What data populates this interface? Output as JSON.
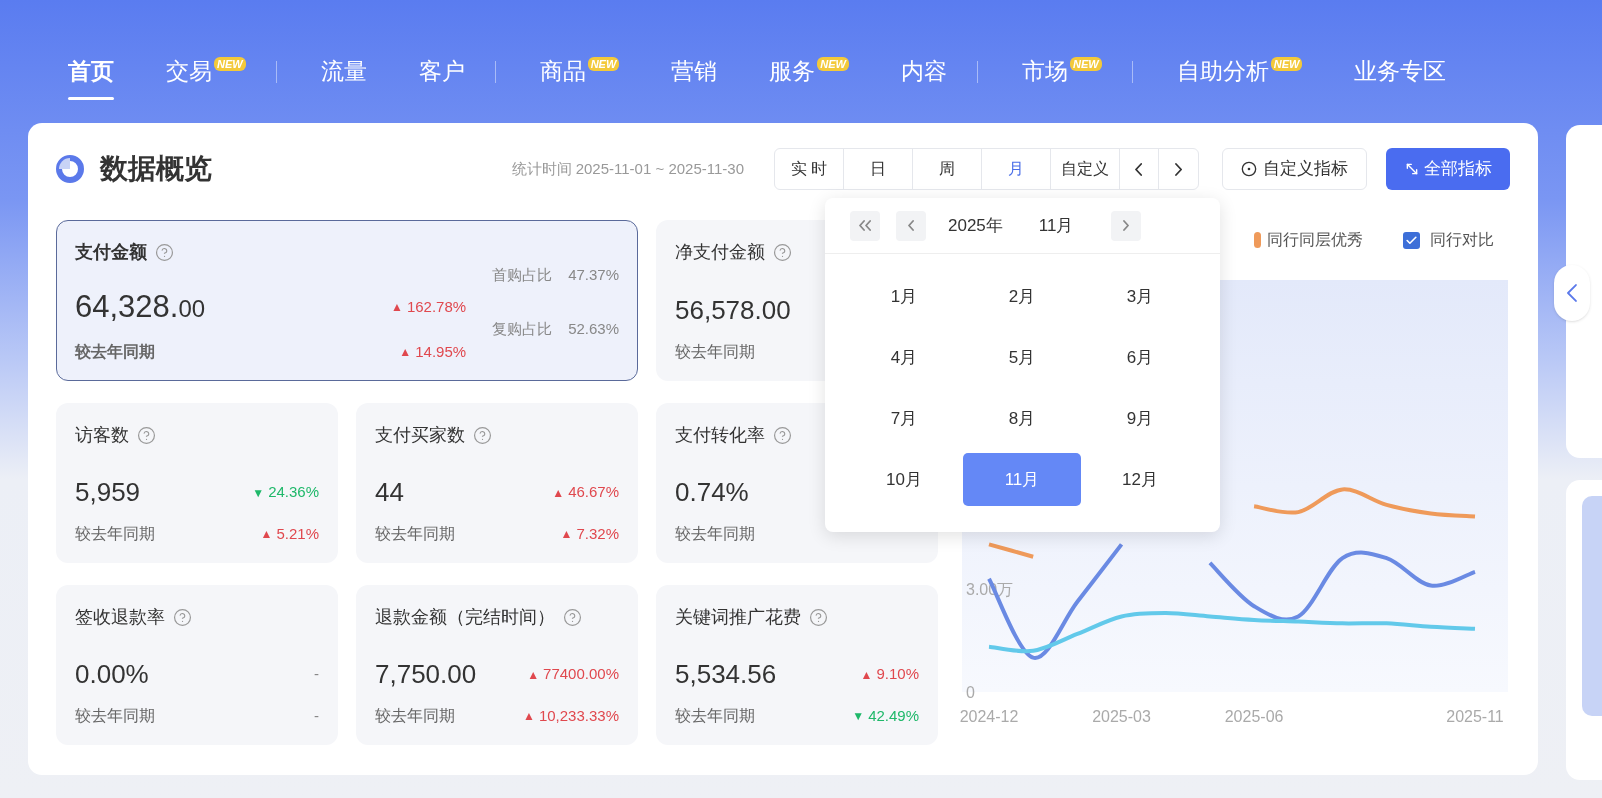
{
  "nav": [
    {
      "kind": "item",
      "label": "首页",
      "selected": true
    },
    {
      "kind": "item",
      "label": "交易",
      "badge": "NEW",
      "selected": false
    },
    {
      "kind": "divider"
    },
    {
      "kind": "item",
      "label": "流量",
      "selected": false
    },
    {
      "kind": "item",
      "label": "客户",
      "selected": false
    },
    {
      "kind": "divider"
    },
    {
      "kind": "item",
      "label": "商品",
      "badge": "NEW",
      "selected": false
    },
    {
      "kind": "item",
      "label": "营销",
      "selected": false
    },
    {
      "kind": "item",
      "label": "服务",
      "badge": "NEW",
      "selected": false
    },
    {
      "kind": "item",
      "label": "内容",
      "selected": false
    },
    {
      "kind": "divider"
    },
    {
      "kind": "item",
      "label": "市场",
      "badge": "NEW",
      "selected": false
    },
    {
      "kind": "divider"
    },
    {
      "kind": "item",
      "label": "自助分析",
      "badge": "NEW",
      "selected": false
    },
    {
      "kind": "item",
      "label": "业务专区",
      "selected": false
    }
  ],
  "overview": {
    "title": "数据概览",
    "period": "统计时间 2025-11-01 ~ 2025-11-30",
    "ranges": [
      {
        "kind": "text",
        "label": "实 时",
        "selected": false
      },
      {
        "kind": "text",
        "label": "日",
        "selected": false
      },
      {
        "kind": "text",
        "label": "周",
        "selected": false
      },
      {
        "kind": "text",
        "label": "月",
        "selected": true
      },
      {
        "kind": "text",
        "label": "自定义",
        "selected": false
      },
      {
        "kind": "prev"
      },
      {
        "kind": "next"
      }
    ],
    "buttons": [
      {
        "kind": "outline",
        "label": "自定义指标"
      },
      {
        "kind": "primary",
        "label": "全部指标"
      }
    ]
  },
  "metrics": [
    {
      "title": "支付金额",
      "value": "64,328.",
      "value_small": "00",
      "selected": true,
      "compare": "较去年同期",
      "change": {
        "kind": "up",
        "arrow": "▲",
        "text": "162.78%"
      },
      "compare_change": {
        "kind": "up",
        "arrow": "▲",
        "text": "14.95%"
      },
      "ratios": [
        {
          "label": "首购占比",
          "value": "47.37%"
        },
        {
          "label": "复购占比",
          "value": "52.63%"
        }
      ]
    },
    {
      "title": "净支付金额",
      "value": "56,578.00",
      "selected": false,
      "compare": "较去年同期"
    },
    {
      "title": "访客数",
      "value": "5,959",
      "selected": false,
      "compare": "较去年同期",
      "change": {
        "kind": "down",
        "arrow": "▼",
        "text": "24.36%"
      },
      "compare_change": {
        "kind": "up",
        "arrow": "▲",
        "text": "5.21%"
      }
    },
    {
      "title": "支付买家数",
      "value": "44",
      "selected": false,
      "compare": "较去年同期",
      "change": {
        "kind": "up",
        "arrow": "▲",
        "text": "46.67%"
      },
      "compare_change": {
        "kind": "up",
        "arrow": "▲",
        "text": "7.32%"
      }
    },
    {
      "title": "支付转化率",
      "value": "0.74%",
      "selected": false,
      "compare": "较去年同期"
    },
    {
      "title": "签收退款率",
      "value": "0.00%",
      "selected": false,
      "compare": "较去年同期",
      "change": {
        "kind": "none",
        "text": "-"
      },
      "compare_change": {
        "kind": "none",
        "text": "-"
      }
    },
    {
      "title": "退款金额（完结时间）",
      "value": "7,750.00",
      "selected": false,
      "compare": "较去年同期",
      "change": {
        "kind": "up",
        "arrow": "▲",
        "text": "77400.00%"
      },
      "compare_change": {
        "kind": "up",
        "arrow": "▲",
        "text": "10,233.33%"
      }
    },
    {
      "title": "关键词推广花费",
      "value": "5,534.56",
      "selected": false,
      "compare": "较去年同期",
      "change": {
        "kind": "up",
        "arrow": "▲",
        "text": "9.10%"
      },
      "compare_change": {
        "kind": "down",
        "arrow": "▼",
        "text": "42.49%"
      }
    }
  ],
  "chart_panel": {
    "compare_toggle": {
      "label": "同行对比",
      "checked": true
    },
    "chart_data": {
      "type": "line",
      "categories": [
        "2024-12",
        null,
        null,
        "2025-03",
        null,
        null,
        "2025-06",
        null,
        null,
        null,
        null,
        "2025-11"
      ],
      "yticks": [
        {
          "value": 0,
          "label": "0"
        },
        {
          "value": 3,
          "label": "3.00万"
        }
      ],
      "ylim": [
        0,
        12
      ],
      "series": [
        {
          "name": "同行同层优秀",
          "color": "#ef9a5a",
          "values": [
            4.3,
            3.94,
            null,
            null,
            null,
            null,
            5.41,
            5.24,
            5.9,
            5.45,
            5.2,
            5.11
          ]
        },
        {
          "color": "#6a8ae3",
          "values": [
            3.3,
            1.0,
            2.63,
            4.3,
            null,
            3.76,
            2.5,
            2.2,
            3.9,
            3.9,
            3.1,
            3.5
          ]
        },
        {
          "color": "#62c9ea",
          "values": [
            1.32,
            1.2,
            1.69,
            2.2,
            2.3,
            2.2,
            2.1,
            2.05,
            2.0,
            2.0,
            1.9,
            1.84
          ]
        }
      ]
    }
  },
  "month_picker": {
    "year": "2025年",
    "month": "11月",
    "months": [
      {
        "label": "1月",
        "selected": false
      },
      {
        "label": "2月",
        "selected": false
      },
      {
        "label": "3月",
        "selected": false
      },
      {
        "label": "4月",
        "selected": false
      },
      {
        "label": "5月",
        "selected": false
      },
      {
        "label": "6月",
        "selected": false
      },
      {
        "label": "7月",
        "selected": false
      },
      {
        "label": "8月",
        "selected": false
      },
      {
        "label": "9月",
        "selected": false
      },
      {
        "label": "10月",
        "selected": false
      },
      {
        "label": "11月",
        "selected": true
      },
      {
        "label": "12月",
        "selected": false
      }
    ]
  }
}
